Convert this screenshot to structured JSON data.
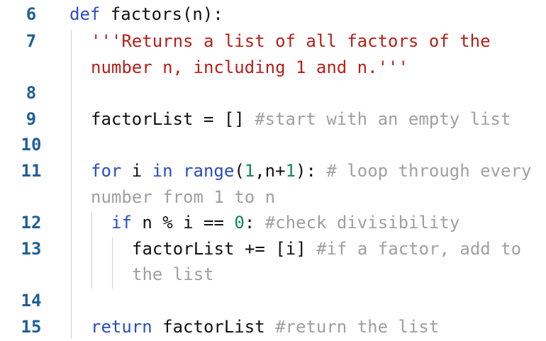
{
  "editor": {
    "line_numbers": {
      "n6": "6",
      "n7": "7",
      "n8": "8",
      "n9": "9",
      "n10": "10",
      "n11": "11",
      "n12": "12",
      "n13": "13",
      "n14": "14",
      "n15": "15"
    },
    "l6": {
      "kw_def": "def",
      "rest": " factors(n):"
    },
    "l7": {
      "str_line1": "'''Returns a list of all factors of the",
      "str_line2": "number n, including 1 and n.'''"
    },
    "l9": {
      "code": "factorList = [] ",
      "comment": "#start with an empty list"
    },
    "l11": {
      "kw_for": "for",
      "t1": " i ",
      "kw_in": "in",
      "t2": " ",
      "fn_range": "range",
      "t3": "(",
      "num1": "1",
      "t4": ",n+",
      "num2": "1",
      "t5": "): ",
      "comment_line1": "# loop through every",
      "comment_line2": "number from 1 to n"
    },
    "l12": {
      "kw_if": "if",
      "t1": " n % i == ",
      "num0": "0",
      "t2": ": ",
      "comment": "#check divisibility"
    },
    "l13": {
      "code": "factorList += [i] ",
      "comment_line1": "#if a factor, add to",
      "comment_line2": "the list"
    },
    "l15": {
      "kw_return": "return",
      "code": " factorList ",
      "comment": "#return the list"
    }
  }
}
